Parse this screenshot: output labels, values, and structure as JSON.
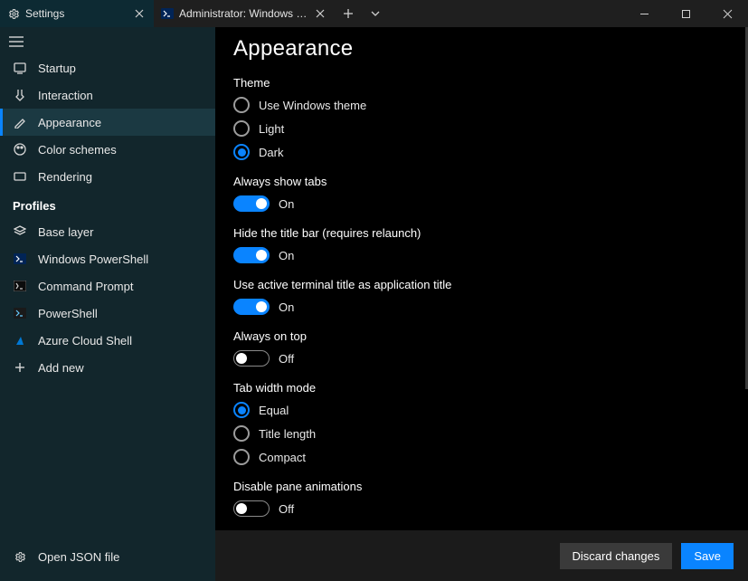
{
  "colors": {
    "accent": "#0a84ff",
    "sidebar_bg": "#12262c",
    "content_bg": "#000000"
  },
  "titlebar": {
    "tabs": [
      {
        "title": "Settings",
        "icon": "gear"
      },
      {
        "title": "Administrator: Windows PowerS",
        "icon": "ps"
      }
    ],
    "newtab": "+",
    "dropdown": "⌄"
  },
  "sidebar": {
    "items": [
      {
        "label": "Startup",
        "icon": "startup"
      },
      {
        "label": "Interaction",
        "icon": "interaction"
      },
      {
        "label": "Appearance",
        "icon": "appearance"
      },
      {
        "label": "Color schemes",
        "icon": "palette"
      },
      {
        "label": "Rendering",
        "icon": "render"
      }
    ],
    "profiles_header": "Profiles",
    "profiles": [
      {
        "label": "Base layer",
        "icon": "layers"
      },
      {
        "label": "Windows PowerShell",
        "icon": "ps"
      },
      {
        "label": "Command Prompt",
        "icon": "cmd"
      },
      {
        "label": "PowerShell",
        "icon": "ps7"
      },
      {
        "label": "Azure Cloud Shell",
        "icon": "azure"
      }
    ],
    "add_new": "Add new",
    "open_json": "Open JSON file"
  },
  "page": {
    "title": "Appearance",
    "theme": {
      "label": "Theme",
      "options": [
        "Use Windows theme",
        "Light",
        "Dark"
      ],
      "selected": 2
    },
    "always_show_tabs": {
      "label": "Always show tabs",
      "on": true,
      "state": "On"
    },
    "hide_title_bar": {
      "label": "Hide the title bar (requires relaunch)",
      "on": true,
      "state": "On"
    },
    "use_active_title": {
      "label": "Use active terminal title as application title",
      "on": true,
      "state": "On"
    },
    "always_on_top": {
      "label": "Always on top",
      "on": false,
      "state": "Off"
    },
    "tab_width": {
      "label": "Tab width mode",
      "options": [
        "Equal",
        "Title length",
        "Compact"
      ],
      "selected": 0
    },
    "disable_pane_anim": {
      "label": "Disable pane animations",
      "on": false,
      "state": "Off"
    }
  },
  "footer": {
    "discard": "Discard changes",
    "save": "Save"
  }
}
